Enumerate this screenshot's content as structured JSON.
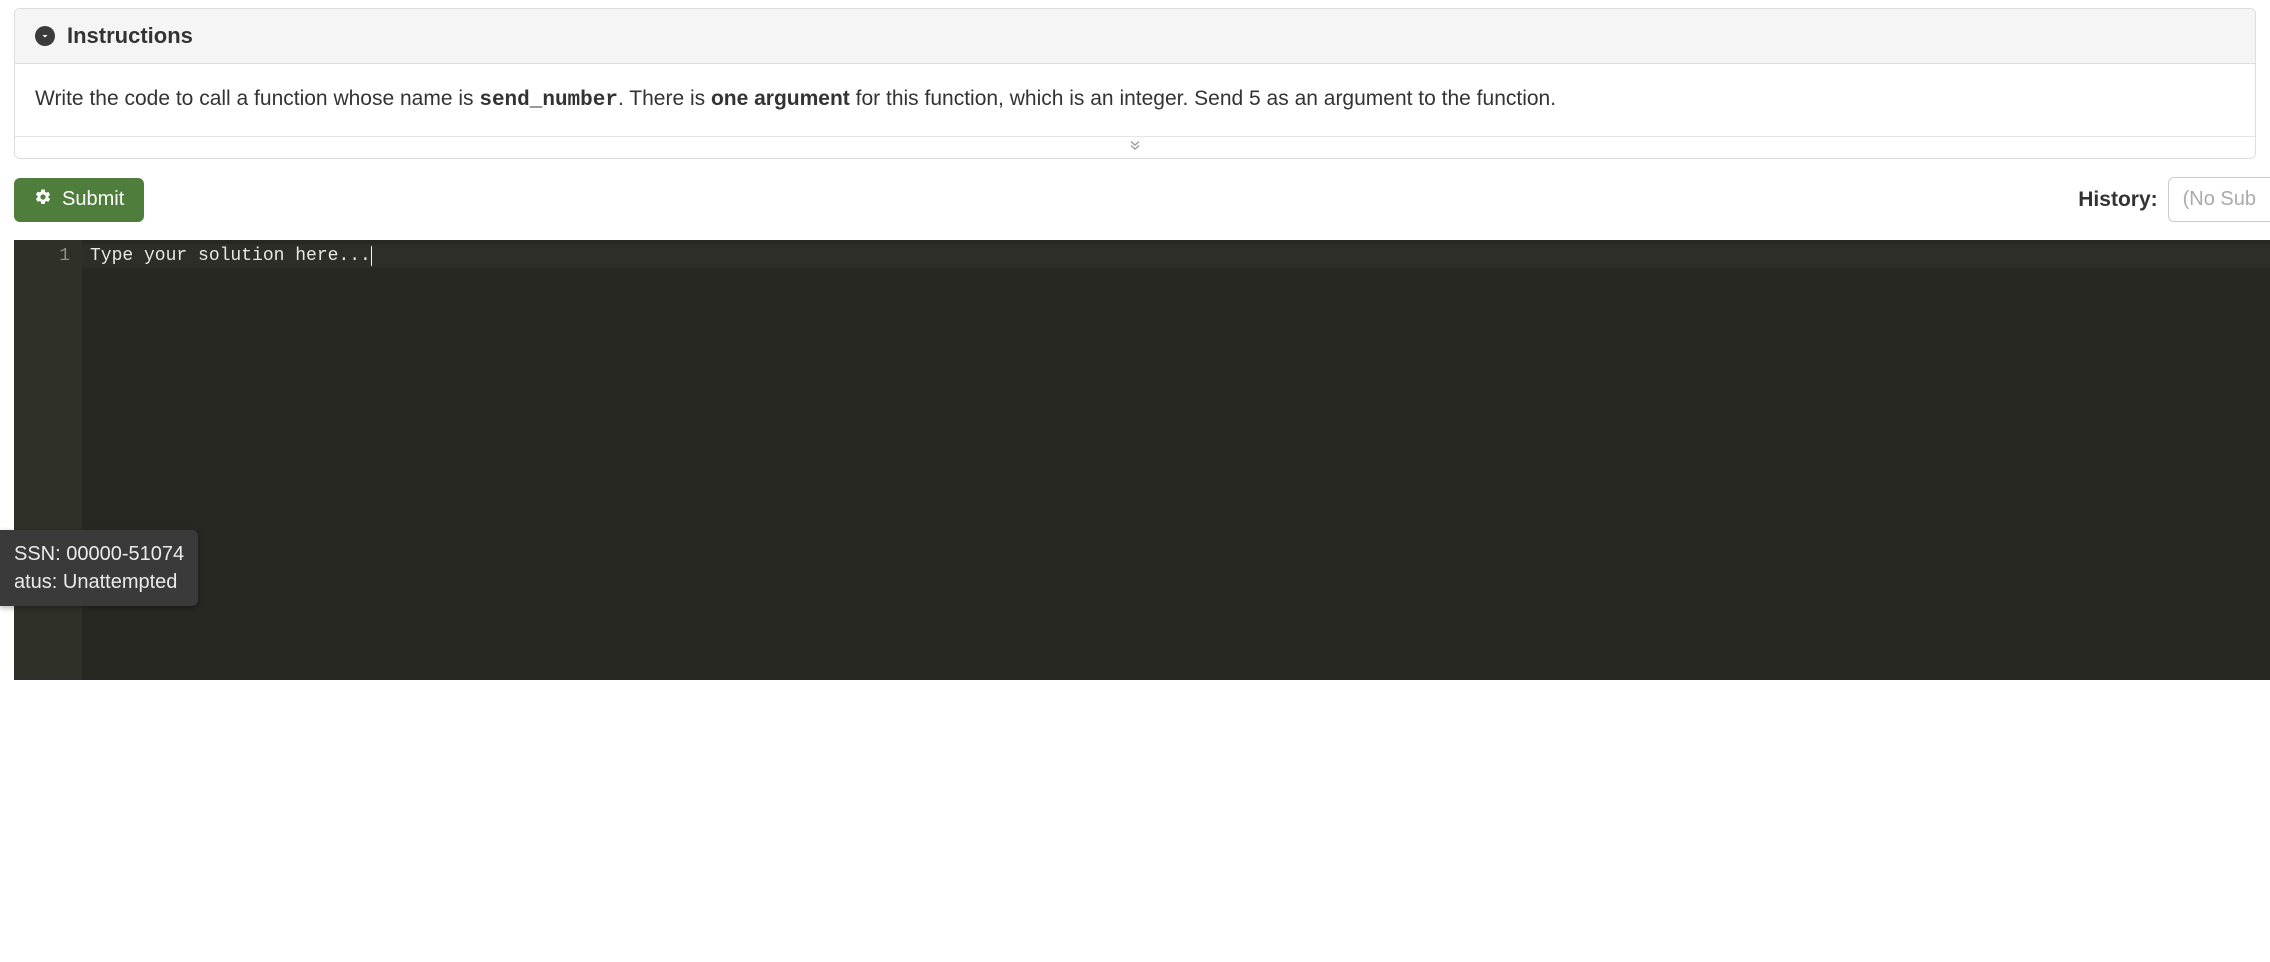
{
  "instructions": {
    "header": "Instructions",
    "text_before_code": "Write the code to call a function whose name is ",
    "function_name": "send_number",
    "text_mid1": ". There is ",
    "bold_phrase": "one argument",
    "text_after": " for this function, which is an integer. Send 5 as an argument to the function."
  },
  "toolbar": {
    "submit_label": "Submit",
    "history_label": "History:",
    "history_placeholder": "(No Sub"
  },
  "editor": {
    "line_number": "1",
    "placeholder": "Type your solution here..."
  },
  "tooltip": {
    "line1": "SSN: 00000-51074",
    "line2": "atus: Unattempted"
  }
}
